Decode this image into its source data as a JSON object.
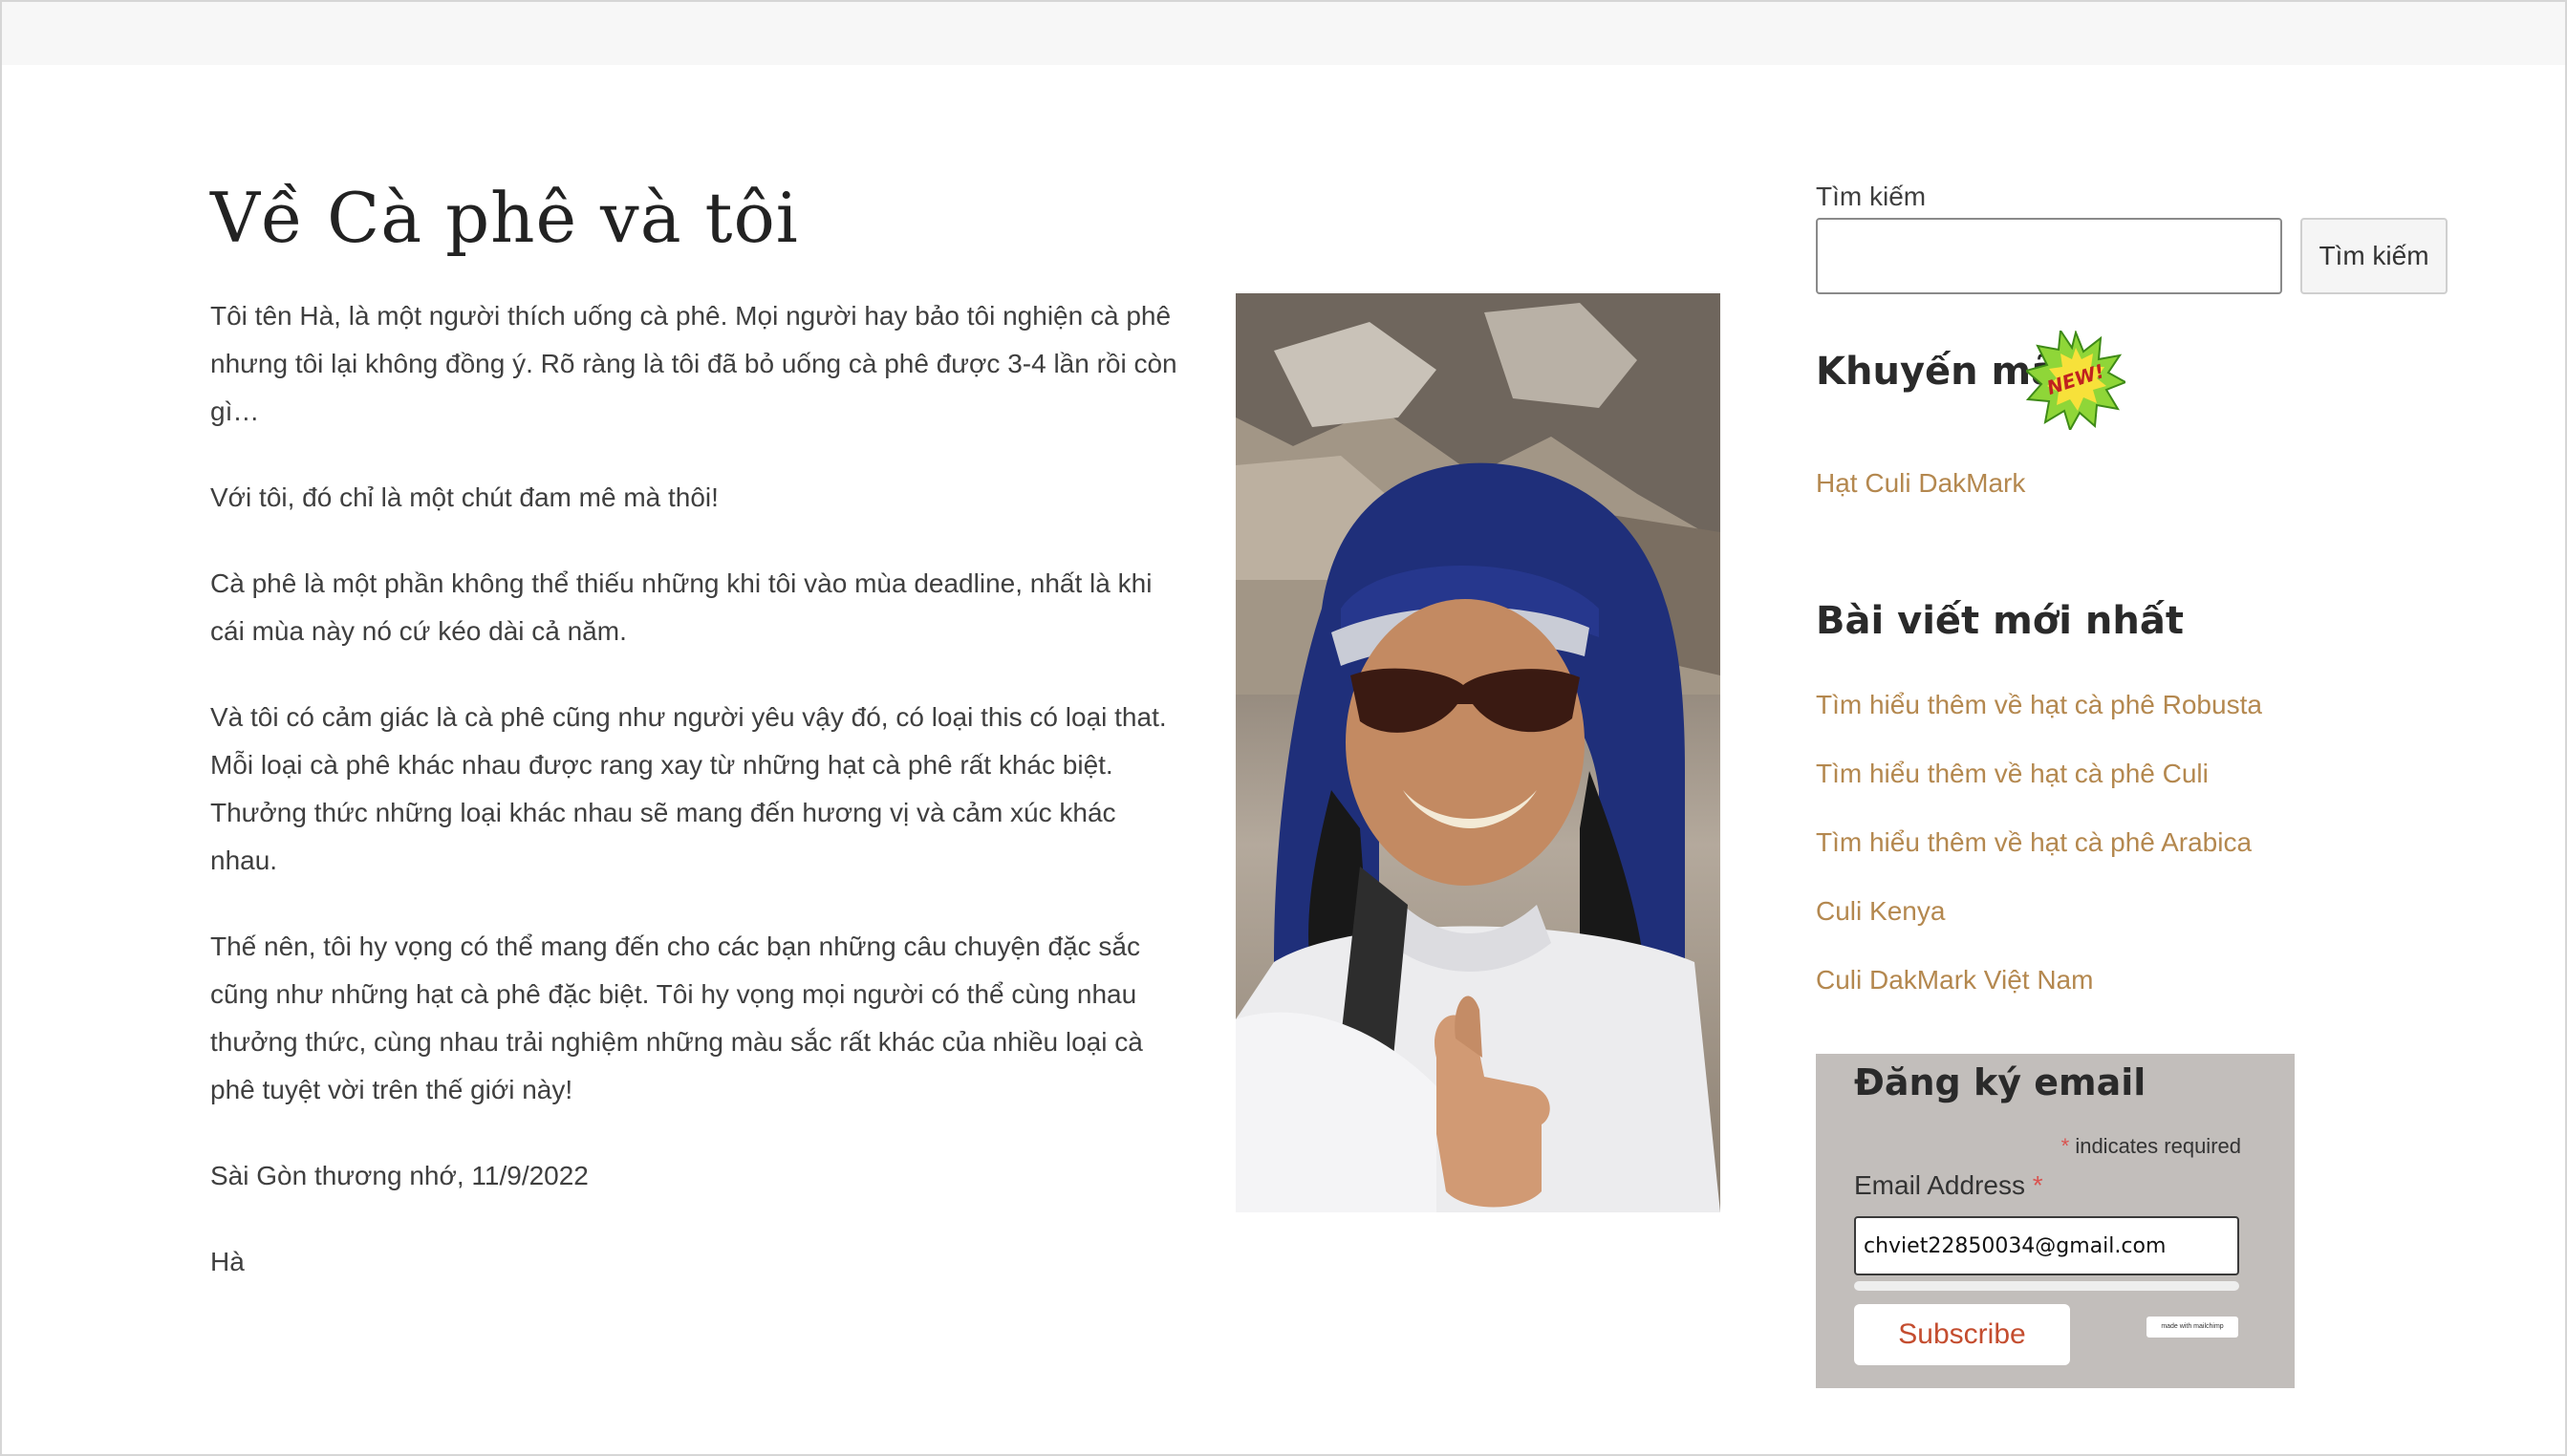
{
  "article": {
    "title": "Về Cà phê và tôi",
    "paragraphs": [
      "Tôi tên Hà, là một người thích uống cà phê. Mọi người hay bảo tôi nghiện cà phê nhưng tôi lại không đồng ý. Rõ ràng là tôi đã bỏ uống cà phê được 3-4 lần rồi còn gì…",
      "Với tôi, đó chỉ là một chút đam mê mà thôi!",
      "Cà phê là một phần không thể thiếu những khi tôi vào mùa deadline, nhất là khi cái mùa này nó cứ kéo dài cả năm.",
      "Và tôi có cảm giác là cà phê cũng như người yêu vậy đó, có loại this có loại that. Mỗi loại cà phê khác nhau được rang xay từ những hạt cà phê rất khác biệt. Thưởng thức những loại khác nhau sẽ mang đến hương vị và cảm xúc khác nhau.",
      "Thế nên, tôi hy vọng có thể mang đến cho các bạn những câu chuyện đặc sắc cũng như những hạt cà phê đặc biệt. Tôi hy vọng mọi người có thể cùng nhau thưởng thức, cùng nhau trải nghiệm những màu sắc rất khác của nhiều loại cà phê tuyệt vời trên thế giới này!",
      "Sài Gòn thương nhớ, 11/9/2022",
      "Hà"
    ]
  },
  "sidebar": {
    "search": {
      "label": "Tìm kiếm",
      "placeholder": "",
      "button_label": "Tìm kiếm"
    },
    "promo": {
      "title": "Khuyến mãi",
      "badge_text": "NEW!",
      "link": "Hạt Culi DakMark"
    },
    "recent": {
      "title": "Bài viết mới nhất",
      "items": [
        "Tìm hiểu thêm về hạt cà phê Robusta",
        "Tìm hiểu thêm về hạt cà phê Culi",
        "Tìm hiểu thêm về hạt cà phê Arabica",
        "Culi Kenya",
        "Culi DakMark Việt Nam"
      ]
    }
  },
  "signup": {
    "title": "Đăng ký email",
    "required_note": "indicates required",
    "asterisk": "*",
    "email_label": "Email Address",
    "email_value": "chviet22850034@gmail.com",
    "subscribe_label": "Subscribe",
    "badge_text": "made with mailchimp"
  },
  "colors": {
    "link": "#b4884f",
    "signup_background": "#c2bebb",
    "subscribe_text": "#c44d2f",
    "required_asterisk": "#d9534f"
  },
  "icons": {
    "promo_badge": "new-starburst-icon"
  }
}
